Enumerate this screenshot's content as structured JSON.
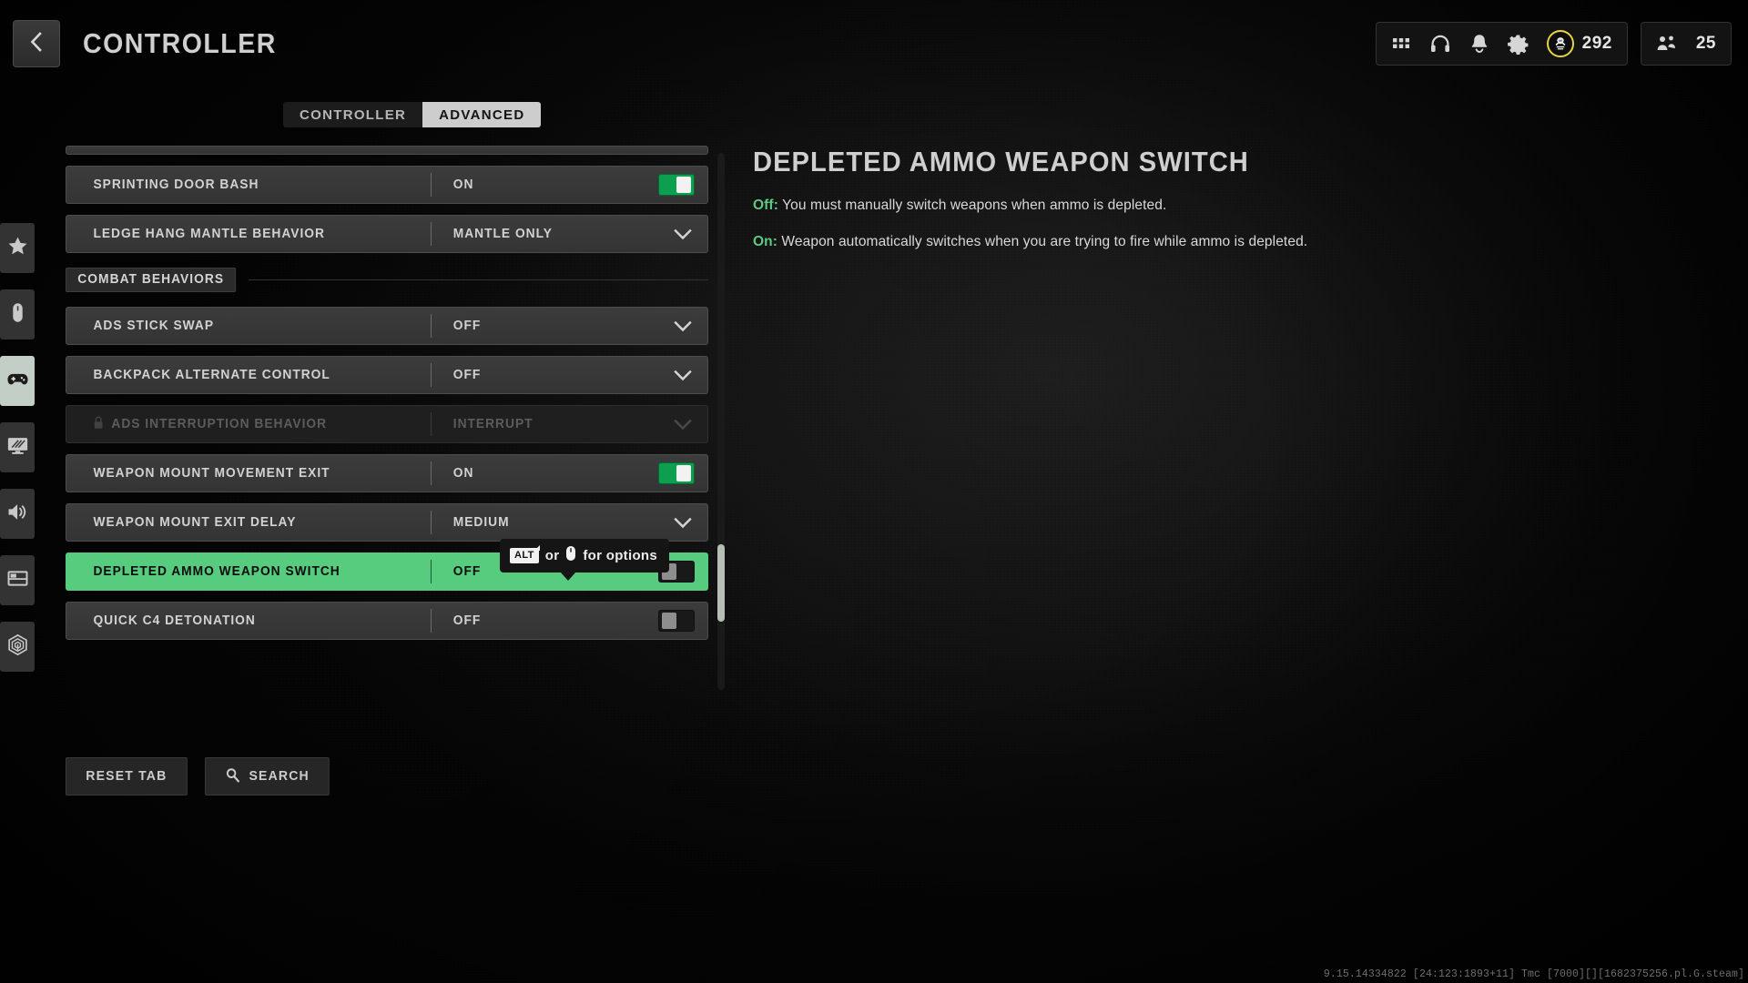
{
  "header": {
    "back_icon": "chevron-left-icon",
    "title": "CONTROLLER",
    "icons": [
      {
        "name": "grid-apps-icon"
      },
      {
        "name": "headphones-icon"
      },
      {
        "name": "bell-notifications-icon"
      },
      {
        "name": "gear-settings-icon"
      }
    ],
    "currency": {
      "icon": "battle-pass-coin-icon",
      "amount": "292"
    },
    "party": {
      "icon": "players-group-icon",
      "count": "25"
    }
  },
  "tabs": [
    {
      "label": "CONTROLLER",
      "active": false
    },
    {
      "label": "ADVANCED",
      "active": true
    }
  ],
  "sidebar": {
    "items": [
      {
        "name": "sidebar-item-favorites",
        "icon": "star-icon",
        "active": false
      },
      {
        "name": "sidebar-item-mouse-keyboard",
        "icon": "mouse-icon",
        "active": false
      },
      {
        "name": "sidebar-item-controller",
        "icon": "gamepad-icon",
        "active": true
      },
      {
        "name": "sidebar-item-graphics",
        "icon": "monitor-icon",
        "active": false
      },
      {
        "name": "sidebar-item-audio",
        "icon": "speaker-icon",
        "active": false
      },
      {
        "name": "sidebar-item-interface",
        "icon": "layout-panels-icon",
        "active": false
      },
      {
        "name": "sidebar-item-account",
        "icon": "network-hexagon-icon",
        "active": false
      }
    ]
  },
  "settings": {
    "rows": [
      {
        "id": "sprinting-door-bash",
        "label": "SPRINTING DOOR BASH",
        "value": "ON",
        "control": "toggle",
        "toggle_state": "on",
        "state": "normal"
      },
      {
        "id": "ledge-hang-mantle-behavior",
        "label": "LEDGE HANG MANTLE BEHAVIOR",
        "value": "MANTLE ONLY",
        "control": "dropdown",
        "state": "normal"
      }
    ],
    "section_header": "COMBAT BEHAVIORS",
    "combat_rows": [
      {
        "id": "ads-stick-swap",
        "label": "ADS STICK SWAP",
        "value": "OFF",
        "control": "dropdown",
        "state": "normal"
      },
      {
        "id": "backpack-alternate-control",
        "label": "BACKPACK ALTERNATE CONTROL",
        "value": "OFF",
        "control": "dropdown",
        "state": "normal"
      },
      {
        "id": "ads-interruption-behavior",
        "label": "ADS INTERRUPTION BEHAVIOR",
        "value": "INTERRUPT",
        "control": "dropdown",
        "state": "disabled",
        "lock_icon": "lock-icon"
      },
      {
        "id": "weapon-mount-movement-exit",
        "label": "WEAPON MOUNT MOVEMENT EXIT",
        "value": "ON",
        "control": "toggle",
        "toggle_state": "on",
        "state": "normal"
      },
      {
        "id": "weapon-mount-exit-delay",
        "label": "WEAPON MOUNT EXIT DELAY",
        "value": "MEDIUM",
        "control": "dropdown",
        "state": "normal"
      },
      {
        "id": "depleted-ammo-weapon-switch",
        "label": "DEPLETED AMMO WEAPON SWITCH",
        "value": "OFF",
        "control": "toggle",
        "toggle_state": "off",
        "state": "selected"
      },
      {
        "id": "quick-c4-detonation",
        "label": "QUICK C4 DETONATION",
        "value": "OFF",
        "control": "toggle",
        "toggle_state": "off",
        "state": "normal"
      }
    ]
  },
  "tooltip": {
    "keycap": "ALT",
    "conjunction": "or",
    "mouse_icon": "mouse-icon",
    "suffix": "for options"
  },
  "detail": {
    "title": "DEPLETED AMMO WEAPON SWITCH",
    "off_key": "Off:",
    "off_text": " You must manually switch weapons when ammo is depleted.",
    "on_key": "On:",
    "on_text": " Weapon automatically switches when you are trying to fire while ammo is depleted."
  },
  "footer": {
    "reset_label": "RESET TAB",
    "search_label": "SEARCH",
    "search_icon": "search-icon",
    "build_string": "9.15.14334822 [24:123:1893+11] Tmc [7000][][1682375256.pl.G.steam]"
  },
  "colors": {
    "accent_green": "#58cc7e",
    "toggle_on": "#0c9f4f",
    "coin_gold": "#e8d53a",
    "text_primary": "#d2d2d2"
  }
}
